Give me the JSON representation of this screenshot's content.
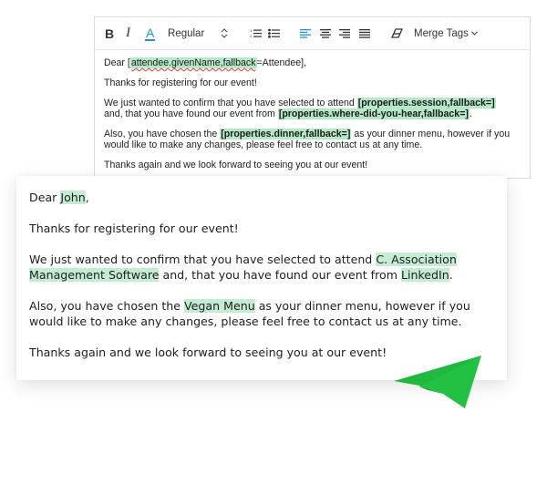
{
  "toolbar": {
    "bold": "B",
    "italic": "I",
    "color": "A",
    "font_style": "Regular",
    "merge_tags": "Merge Tags"
  },
  "editor": {
    "greeting_prefix": "Dear [",
    "greeting_tag": "attendee.givenName,fallback",
    "greeting_suffix": "=Attendee],",
    "thanks": "Thanks for registering for our event!",
    "confirm_prefix": "We just wanted to confirm that you have selected to attend ",
    "session_tag": "[properties.session,fallback=]",
    "confirm_middle": "and, that you have found our event from ",
    "source_tag": "[properties.where-did-you-hear,fallback=]",
    "confirm_end": ".",
    "dinner_prefix": "Also, you have chosen the ",
    "dinner_tag": "[properties.dinner,fallback=]",
    "dinner_suffix": " as your dinner menu, however if you would like to make any changes, please feel free to contact us at any time.",
    "closing": "Thanks again and we look forward to seeing you at our event!"
  },
  "preview": {
    "greeting_prefix": "Dear ",
    "name": "John",
    "greeting_suffix": ",",
    "thanks": "Thanks for registering for our event!",
    "confirm_prefix": "We just wanted to confirm that you have selected to attend ",
    "session": "C. Association Management Software",
    "confirm_middle": " and, that you have found our event from ",
    "source": "LinkedIn",
    "confirm_end": ".",
    "dinner_prefix": "Also, you have chosen the ",
    "dinner": "Vegan Menu",
    "dinner_suffix": " as your dinner menu, however if you would like to make any changes, please feel free to contact us at any time.",
    "closing": "Thanks again and we look forward to seeing you at our event!"
  },
  "colors": {
    "tag_highlight": "#b5e8c6",
    "preview_highlight": "#c4ecd2",
    "accent_blue": "#2a8fd6",
    "plane_green": "#1fb53c"
  },
  "icons": [
    "bold-icon",
    "italic-icon",
    "text-color-icon",
    "up-down-icon",
    "ordered-list-icon",
    "unordered-list-icon",
    "align-left-icon",
    "align-center-icon",
    "align-right-icon",
    "align-justify-icon",
    "eraser-icon",
    "chevron-down-icon",
    "paper-plane-icon"
  ]
}
